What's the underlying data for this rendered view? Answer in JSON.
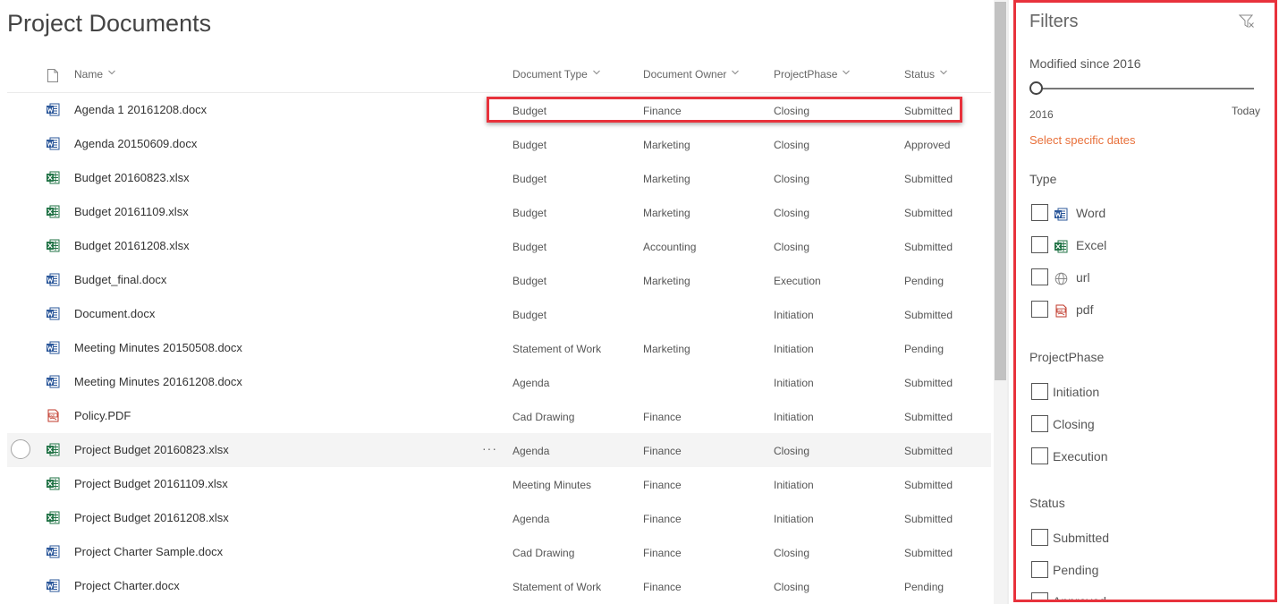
{
  "page": {
    "title": "Project Documents"
  },
  "columns": {
    "name": "Name",
    "document_type": "Document Type",
    "document_owner": "Document Owner",
    "project_phase": "ProjectPhase",
    "status": "Status"
  },
  "rows": [
    {
      "icon": "word-icon",
      "name": "Agenda 1 20161208.docx",
      "type": "Budget",
      "owner": "Finance",
      "phase": "Closing",
      "status": "Submitted"
    },
    {
      "icon": "word-icon",
      "name": "Agenda 20150609.docx",
      "type": "Budget",
      "owner": "Marketing",
      "phase": "Closing",
      "status": "Approved"
    },
    {
      "icon": "excel-icon",
      "name": "Budget 20160823.xlsx",
      "type": "Budget",
      "owner": "Marketing",
      "phase": "Closing",
      "status": "Submitted"
    },
    {
      "icon": "excel-icon",
      "name": "Budget 20161109.xlsx",
      "type": "Budget",
      "owner": "Marketing",
      "phase": "Closing",
      "status": "Submitted"
    },
    {
      "icon": "excel-icon",
      "name": "Budget 20161208.xlsx",
      "type": "Budget",
      "owner": "Accounting",
      "phase": "Closing",
      "status": "Submitted"
    },
    {
      "icon": "word-icon",
      "name": "Budget_final.docx",
      "type": "Budget",
      "owner": "Marketing",
      "phase": "Execution",
      "status": "Pending"
    },
    {
      "icon": "word-icon",
      "name": "Document.docx",
      "type": "Budget",
      "owner": "",
      "phase": "Initiation",
      "status": "Submitted"
    },
    {
      "icon": "word-icon",
      "name": "Meeting Minutes 20150508.docx",
      "type": "Statement of Work",
      "owner": "Marketing",
      "phase": "Initiation",
      "status": "Pending"
    },
    {
      "icon": "word-icon",
      "name": "Meeting Minutes 20161208.docx",
      "type": "Agenda",
      "owner": "",
      "phase": "Initiation",
      "status": "Submitted"
    },
    {
      "icon": "pdf-icon",
      "name": "Policy.PDF",
      "type": "Cad Drawing",
      "owner": "Finance",
      "phase": "Initiation",
      "status": "Submitted"
    },
    {
      "icon": "excel-icon",
      "name": "Project Budget 20160823.xlsx",
      "type": "Agenda",
      "owner": "Finance",
      "phase": "Closing",
      "status": "Submitted",
      "more": "···"
    },
    {
      "icon": "excel-icon",
      "name": "Project Budget 20161109.xlsx",
      "type": "Meeting Minutes",
      "owner": "Finance",
      "phase": "Initiation",
      "status": "Submitted"
    },
    {
      "icon": "excel-icon",
      "name": "Project Budget 20161208.xlsx",
      "type": "Agenda",
      "owner": "Finance",
      "phase": "Initiation",
      "status": "Submitted"
    },
    {
      "icon": "word-icon",
      "name": "Project Charter Sample.docx",
      "type": "Cad Drawing",
      "owner": "Finance",
      "phase": "Closing",
      "status": "Submitted"
    },
    {
      "icon": "word-icon",
      "name": "Project Charter.docx",
      "type": "Statement of Work",
      "owner": "Finance",
      "phase": "Closing",
      "status": "Pending"
    }
  ],
  "filters": {
    "title": "Filters",
    "modified": {
      "label": "Modified since 2016",
      "min_label": "2016",
      "max_label": "Today",
      "slider_value": 0,
      "link": "Select specific dates"
    },
    "type": {
      "heading": "Type",
      "options": [
        "Word",
        "Excel",
        "url",
        "pdf"
      ]
    },
    "phase": {
      "heading": "ProjectPhase",
      "options": [
        "Initiation",
        "Closing",
        "Execution"
      ]
    },
    "status": {
      "heading": "Status",
      "options": [
        "Submitted",
        "Pending",
        "Approved"
      ]
    }
  },
  "colors": {
    "accent_red": "#e8323c",
    "link_orange": "#e8703a",
    "word_blue": "#2b579a",
    "excel_green": "#217346",
    "pdf_red": "#c0392b"
  }
}
